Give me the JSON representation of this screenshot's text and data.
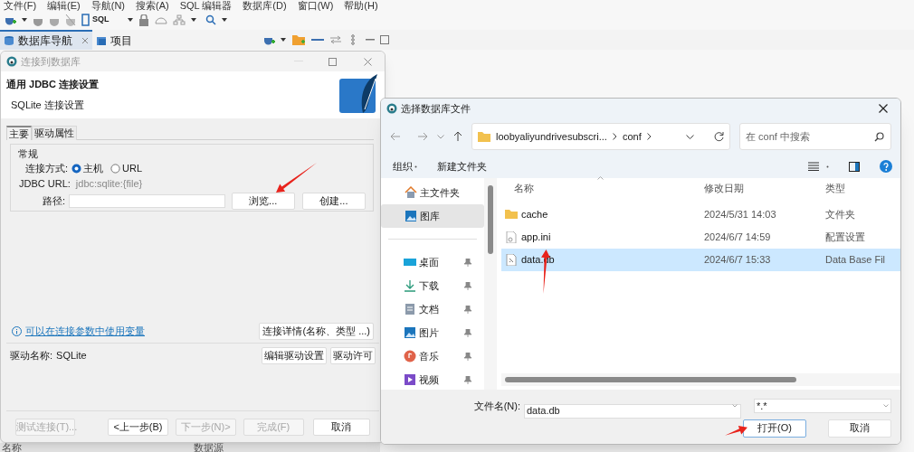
{
  "menu": [
    "文件(F)",
    "编辑(E)",
    "导航(N)",
    "搜索(A)",
    "SQL 编辑器",
    "数据库(D)",
    "窗口(W)",
    "帮助(H)"
  ],
  "toolbar": {
    "sql_label": "SQL"
  },
  "panel_tabs": [
    {
      "label": "数据库导航",
      "selected": true,
      "closable": true
    },
    {
      "label": "项目",
      "selected": false,
      "closable": false
    }
  ],
  "connect_dialog": {
    "title": "连接到数据库",
    "active": false,
    "heading": "通用 JDBC 连接设置",
    "subheading": "SQLite 连接设置",
    "tabs": [
      {
        "label": "主要",
        "selected": true
      },
      {
        "label": "驱动属性",
        "selected": false
      }
    ],
    "group": "常规",
    "mode_label": "连接方式:",
    "modes": [
      {
        "label": "主机",
        "selected": true
      },
      {
        "label": "URL",
        "selected": false
      }
    ],
    "url_label": "JDBC URL:",
    "url_value": "jdbc:sqlite:{file}",
    "path_label": "路径:",
    "path_buttons": [
      "浏览...",
      "创建..."
    ],
    "info_link": "可以在连接参数中使用变量",
    "details_button": "连接详情(名称、类型 ...)",
    "driver_label": "驱动名称:",
    "driver_name": "SQLite",
    "driver_buttons": [
      "编辑驱动设置",
      "驱动许可"
    ],
    "footer_buttons": [
      {
        "label": "测试连接(T)...",
        "disabled": true
      },
      {
        "label": "<上一步(B)",
        "disabled": false
      },
      {
        "label": "下一步(N)>",
        "disabled": true
      },
      {
        "label": "完成(F)",
        "disabled": true
      },
      {
        "label": "取消",
        "disabled": false
      }
    ]
  },
  "file_dialog": {
    "title": "选择数据库文件",
    "path": [
      "loobyaliyundrivesubscri...",
      "conf"
    ],
    "search_placeholder": "在 conf 中搜索",
    "commands": [
      "组织",
      "新建文件夹"
    ],
    "nav": [
      {
        "label": "主文件夹",
        "pinned": false,
        "selected": false
      },
      {
        "label": "图库",
        "pinned": false,
        "selected": true
      },
      {
        "label": "桌面",
        "pinned": true,
        "selected": false
      },
      {
        "label": "下载",
        "pinned": true,
        "selected": false
      },
      {
        "label": "文档",
        "pinned": true,
        "selected": false
      },
      {
        "label": "图片",
        "pinned": true,
        "selected": false
      },
      {
        "label": "音乐",
        "pinned": true,
        "selected": false
      },
      {
        "label": "视频",
        "pinned": true,
        "selected": false
      }
    ],
    "columns": [
      "名称",
      "修改日期",
      "类型"
    ],
    "rows": [
      {
        "kind": "folder",
        "name": "cache",
        "modified": "2024/5/31 14:03",
        "type": "文件夹",
        "selected": false
      },
      {
        "kind": "settings",
        "name": "app.ini",
        "modified": "2024/6/7 14:59",
        "type": "配置设置",
        "selected": false
      },
      {
        "kind": "data",
        "name": "data.db",
        "modified": "2024/6/7 15:33",
        "type": "Data Base Fil",
        "selected": true
      }
    ],
    "filename_label": "文件名(N):",
    "filename": "data.db",
    "filter": "*.*",
    "buttons": [
      {
        "label": "打开(O)",
        "default": true
      },
      {
        "label": "取消",
        "default": false
      }
    ]
  },
  "background_table": {
    "columns": [
      "名称",
      "数据源"
    ]
  }
}
